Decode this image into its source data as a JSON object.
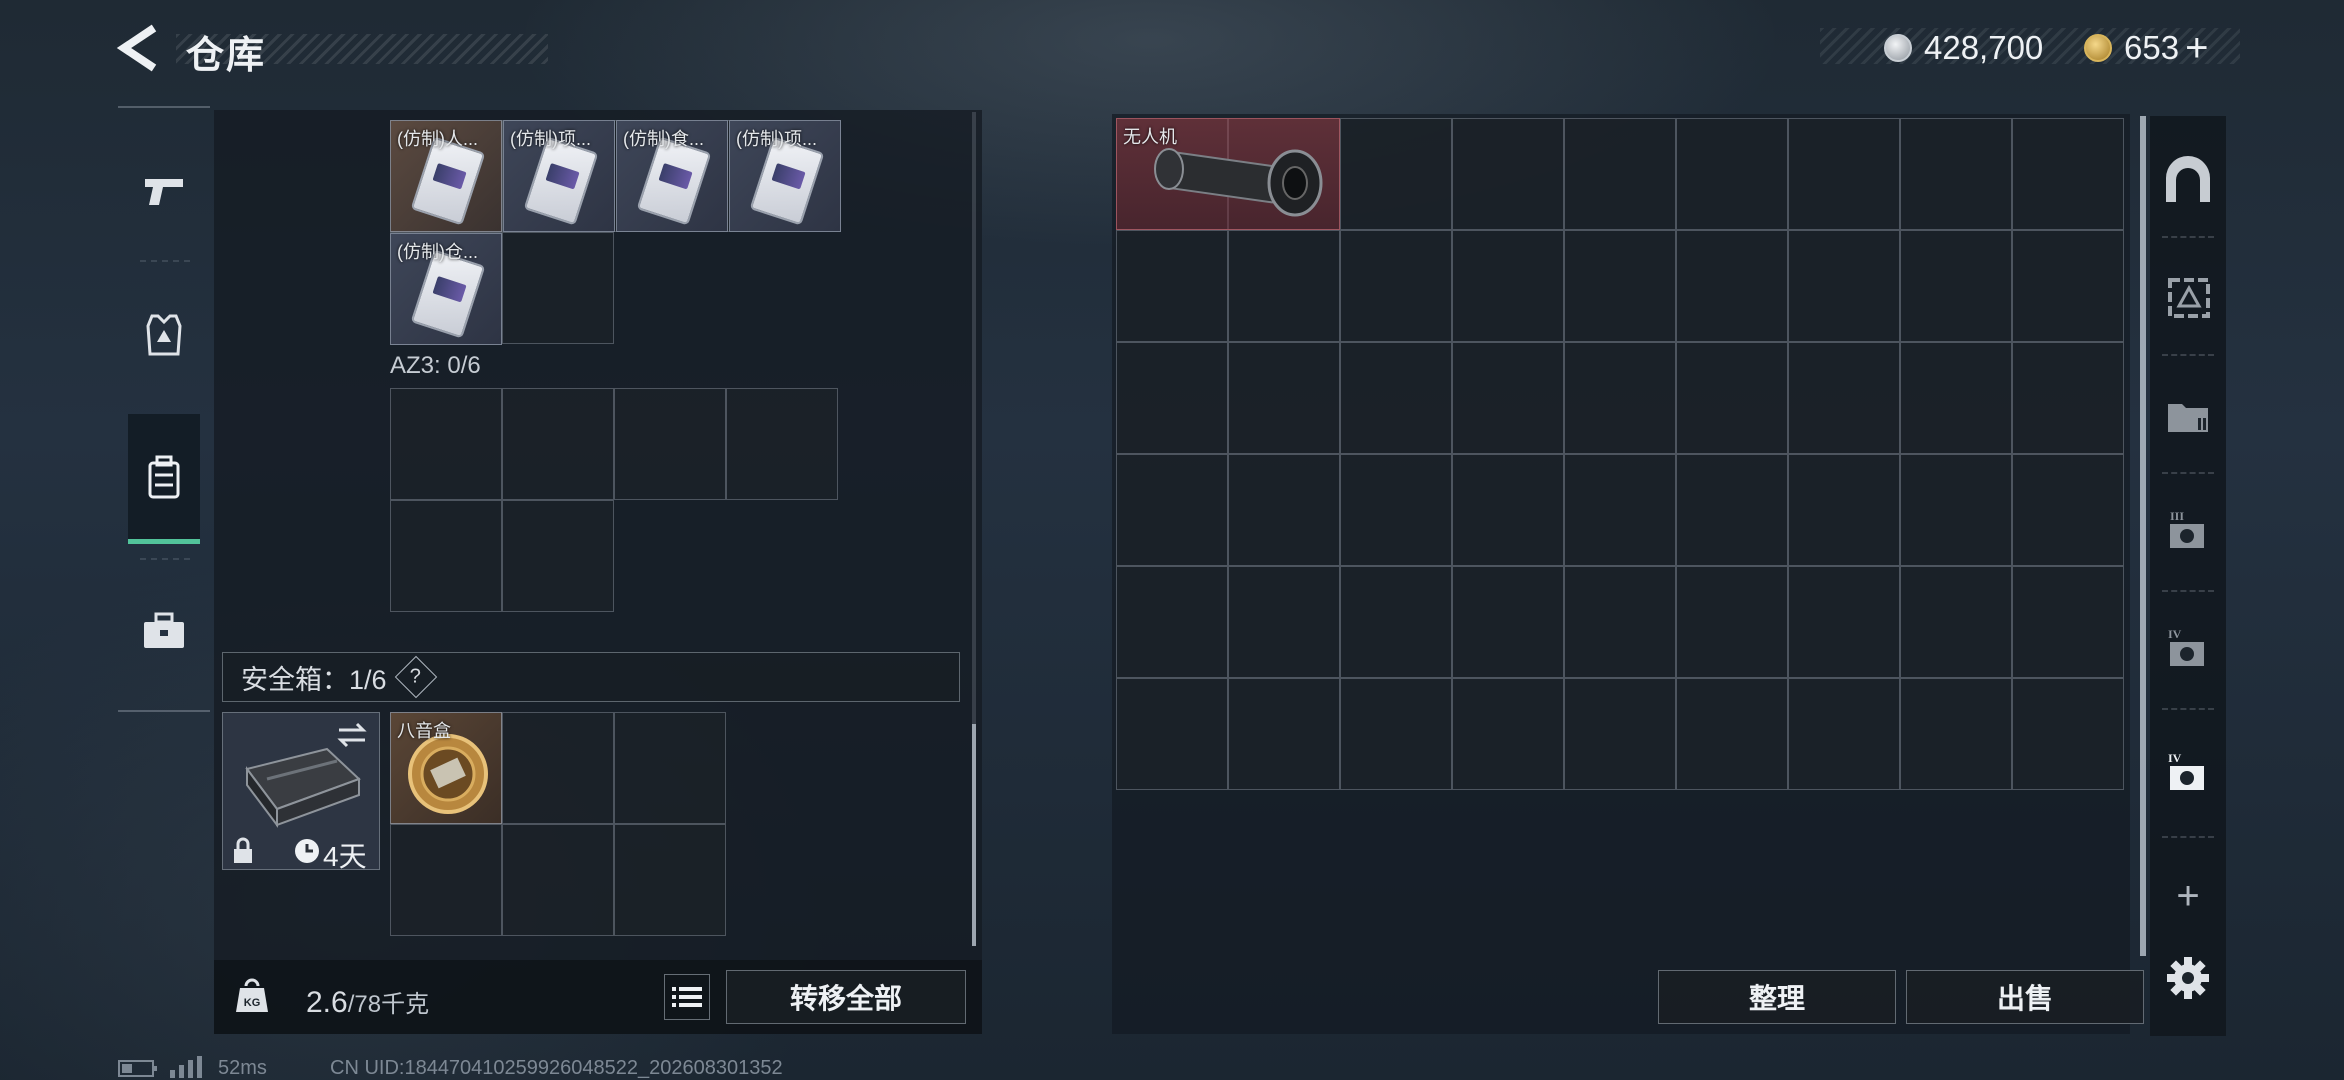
{
  "header": {
    "title": "仓库",
    "currency": [
      {
        "icon": "silver-coin-icon",
        "value": "428,700"
      },
      {
        "icon": "gold-triangle-coin-icon",
        "value": "653"
      }
    ],
    "plus": "+"
  },
  "left_rail": {
    "items": [
      {
        "icon": "gun-icon"
      },
      {
        "icon": "armor-vest-icon"
      },
      {
        "icon": "backpack-icon",
        "active": true
      },
      {
        "icon": "briefcase-icon"
      }
    ]
  },
  "left_panel": {
    "items": [
      {
        "label": "(仿制)人..."
      },
      {
        "label": "(仿制)项..."
      },
      {
        "label": "(仿制)食..."
      },
      {
        "label": "(仿制)项..."
      },
      {
        "label": "(仿制)仓..."
      }
    ],
    "az_label": "AZ3: 0/6",
    "safe_box": {
      "label": "安全箱：1/6",
      "help": "?",
      "days": "4天",
      "item_label": "八音盒"
    },
    "weight": {
      "current": "2.6",
      "max": "/78千克"
    },
    "transfer_all": "转移全部"
  },
  "right_panel": {
    "item_label": "无人机",
    "sort_button": "整理",
    "sell_button": "出售"
  },
  "right_rail": {
    "plus": "+",
    "items": [
      {
        "icon": "vault-arch-icon"
      },
      {
        "icon": "container-level3-icon"
      },
      {
        "icon": "folder-stack-icon"
      },
      {
        "icon": "camera-level3-icon"
      },
      {
        "icon": "camera-level4-icon"
      },
      {
        "icon": "camera-level4-active-icon"
      }
    ]
  },
  "status_bar": {
    "ping": "52ms",
    "uid": "CN UID:18447041025992604852​2_202608301352"
  }
}
